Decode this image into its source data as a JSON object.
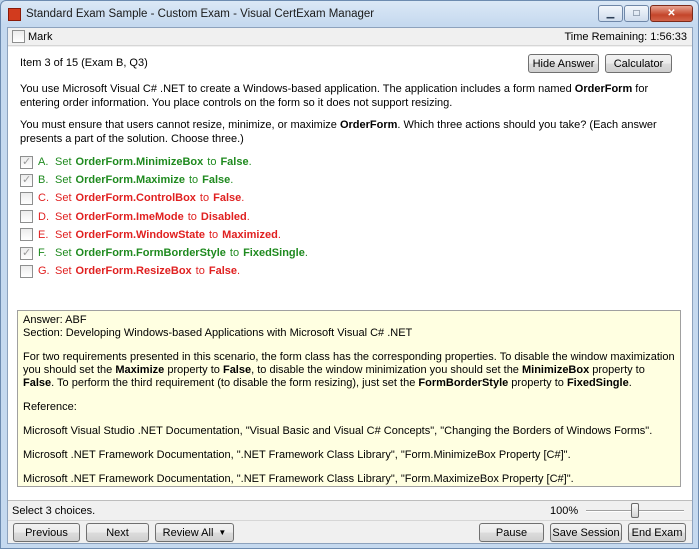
{
  "window": {
    "title": "Standard Exam Sample - Custom Exam - Visual CertExam Manager",
    "minimize_glyph": "▁",
    "maximize_glyph": "□",
    "close_glyph": "✕"
  },
  "markbar": {
    "mark_label": "Mark",
    "mark_checked": false,
    "time_remaining": "Time Remaining: 1:56:33"
  },
  "question": {
    "item_label": "Item 3 of 15  (Exam B, Q3)",
    "hide_answer_label": "Hide Answer",
    "calculator_label": "Calculator",
    "para1": {
      "a": "You use Microsoft Visual C# .NET to create a Windows-based application. The application includes a form named ",
      "b": "OrderForm",
      "c": " for entering order information. You place controls on the form so it does not support resizing."
    },
    "para2": {
      "a": "You must ensure that users cannot resize, minimize, or maximize ",
      "b": "OrderForm",
      "c": ". Which three actions should you take? (Each answer presents a part of the solution. Choose three.)"
    }
  },
  "answers": [
    {
      "letter": "A.",
      "pre": "Set",
      "prop": "OrderForm.MinimizeBox",
      "to": "to",
      "val": "False",
      "end": ".",
      "checked": true,
      "correct": true
    },
    {
      "letter": "B.",
      "pre": "Set",
      "prop": "OrderForm.Maximize",
      "to": "to",
      "val": "False",
      "end": ".",
      "checked": true,
      "correct": true
    },
    {
      "letter": "C.",
      "pre": "Set",
      "prop": "OrderForm.ControlBox",
      "to": "to",
      "val": "False",
      "end": ".",
      "checked": false,
      "correct": false
    },
    {
      "letter": "D.",
      "pre": "Set",
      "prop": "OrderForm.ImeMode",
      "to": "to",
      "val": "Disabled",
      "end": ".",
      "checked": false,
      "correct": false
    },
    {
      "letter": "E.",
      "pre": "Set",
      "prop": "OrderForm.WindowState",
      "to": "to",
      "val": "Maximized",
      "end": ".",
      "checked": false,
      "correct": false
    },
    {
      "letter": "F.",
      "pre": "Set",
      "prop": "OrderForm.FormBorderStyle",
      "to": "to",
      "val": "FixedSingle",
      "end": ".",
      "checked": true,
      "correct": true
    },
    {
      "letter": "G.",
      "pre": "Set",
      "prop": "OrderForm.ResizeBox",
      "to": "to",
      "val": "False",
      "end": ".",
      "checked": false,
      "correct": false
    }
  ],
  "explanation": {
    "answer_line": "Answer: ABF",
    "section_line": "Section: Developing Windows-based Applications with Microsoft Visual C# .NET",
    "para": {
      "t1": "For two requirements presented in this scenario, the form class has the corresponding properties. To disable the window maximization you should set the ",
      "b1": "Maximize",
      "t2": " property to ",
      "b2": "False",
      "t3": ", to disable the window minimization you should set the ",
      "b3": "MinimizeBox",
      "t4": " property to ",
      "b4": "False",
      "t5": ". To perform the third requirement (to disable the form resizing), just set the ",
      "b5": "FormBorderStyle",
      "t6": " property to ",
      "b6": "FixedSingle",
      "t7": "."
    },
    "reference_label": "Reference:",
    "refs": [
      "Microsoft Visual Studio .NET Documentation, \"Visual Basic and Visual C# Concepts\", \"Changing the Borders of Windows Forms\".",
      "Microsoft .NET Framework Documentation, \".NET Framework Class Library\", \"Form.MinimizeBox Property [C#]\".",
      "Microsoft .NET Framework Documentation, \".NET Framework Class Library\", \"Form.MaximizeBox Property [C#]\"."
    ]
  },
  "status": {
    "text": "Select 3 choices.",
    "zoom": "100%",
    "zoom_level": 0.5
  },
  "buttons": {
    "previous": "Previous",
    "next": "Next",
    "review_all": "Review All",
    "review_arrow": "▼",
    "pause": "Pause",
    "save_session": "Save Session",
    "end_exam": "End Exam"
  },
  "colors": {
    "correct": "#1f8a1f",
    "wrong": "#e02020",
    "explanation_bg": "#ffffe1"
  }
}
